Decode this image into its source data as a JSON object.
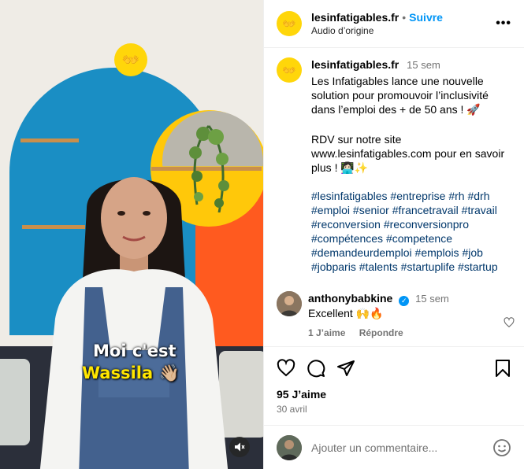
{
  "header": {
    "username": "lesinfatigables.fr",
    "separator": "•",
    "follow_label": "Suivre",
    "audio_label": "Audio d’origine",
    "more_label": "•••"
  },
  "media": {
    "caption_line1": "Moi c'est",
    "caption_line2": "Wassila 👋🏼",
    "logo_glyph": "👐"
  },
  "post_caption": {
    "username": "lesinfatigables.fr",
    "time": "15 sem",
    "text1": "Les Infatigables lance une nouvelle solution pour promouvoir l’inclusivité dans l’emploi des + de 50 ans ! 🚀",
    "text2": "RDV sur notre site www.lesinfatigables.com pour en savoir plus ! 👩🏻‍💻✨",
    "hashtags": [
      "#lesinfatigables",
      "#entreprise",
      "#rh",
      "#drh",
      "#emploi",
      "#senior",
      "#francetravail",
      "#travail",
      "#reconversion",
      "#reconversionpro",
      "#compétences",
      "#competence",
      "#demandeurdemploi",
      "#emplois",
      "#job",
      "#jobparis",
      "#talents",
      "#startuplife",
      "#startup"
    ]
  },
  "comment": {
    "username": "anthonybabkine",
    "time": "15 sem",
    "text": "Excellent 🙌🔥",
    "likes": "1 J’aime",
    "reply_label": "Répondre"
  },
  "actions": {
    "likes_count": "95 J’aime",
    "date": "30 avril"
  },
  "composer": {
    "placeholder": "Ajouter un commentaire..."
  },
  "colors": {
    "link": "#00376b",
    "follow": "#0095f6",
    "brand_yellow": "#ffd60a"
  }
}
